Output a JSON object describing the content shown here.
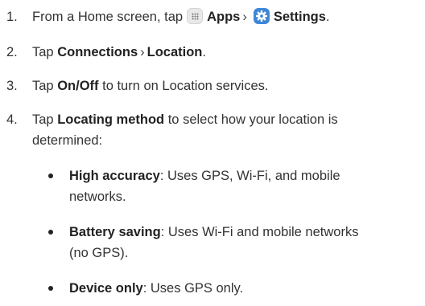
{
  "steps": [
    {
      "number": "1.",
      "prefix": "From a Home screen, tap",
      "apps_label": "Apps",
      "separator": "›",
      "settings_label": "Settings",
      "suffix": "."
    },
    {
      "number": "2.",
      "prefix": "Tap",
      "connections_label": "Connections",
      "separator": "›",
      "location_label": "Location",
      "suffix": "."
    },
    {
      "number": "3.",
      "prefix": "Tap",
      "onoff_label": "On/Off",
      "suffix": "to turn on Location services."
    },
    {
      "number": "4.",
      "prefix": "Tap",
      "method_label": "Locating method",
      "suffix_line1": "to select how your location is",
      "suffix_line2": "determined:"
    }
  ],
  "bullets": [
    {
      "title": "High accuracy",
      "line1": ": Uses GPS, Wi-Fi, and mobile",
      "line2": "networks."
    },
    {
      "title": "Battery saving",
      "line1": ": Uses Wi-Fi and mobile networks",
      "line2": "(no GPS)."
    },
    {
      "title": "Device only",
      "line1": ": Uses GPS only."
    }
  ],
  "icons": {
    "apps": "apps-grid-icon",
    "settings": "settings-gear-icon",
    "settings_color": "#3f86d9",
    "apps_color": "#e9e9e9"
  }
}
